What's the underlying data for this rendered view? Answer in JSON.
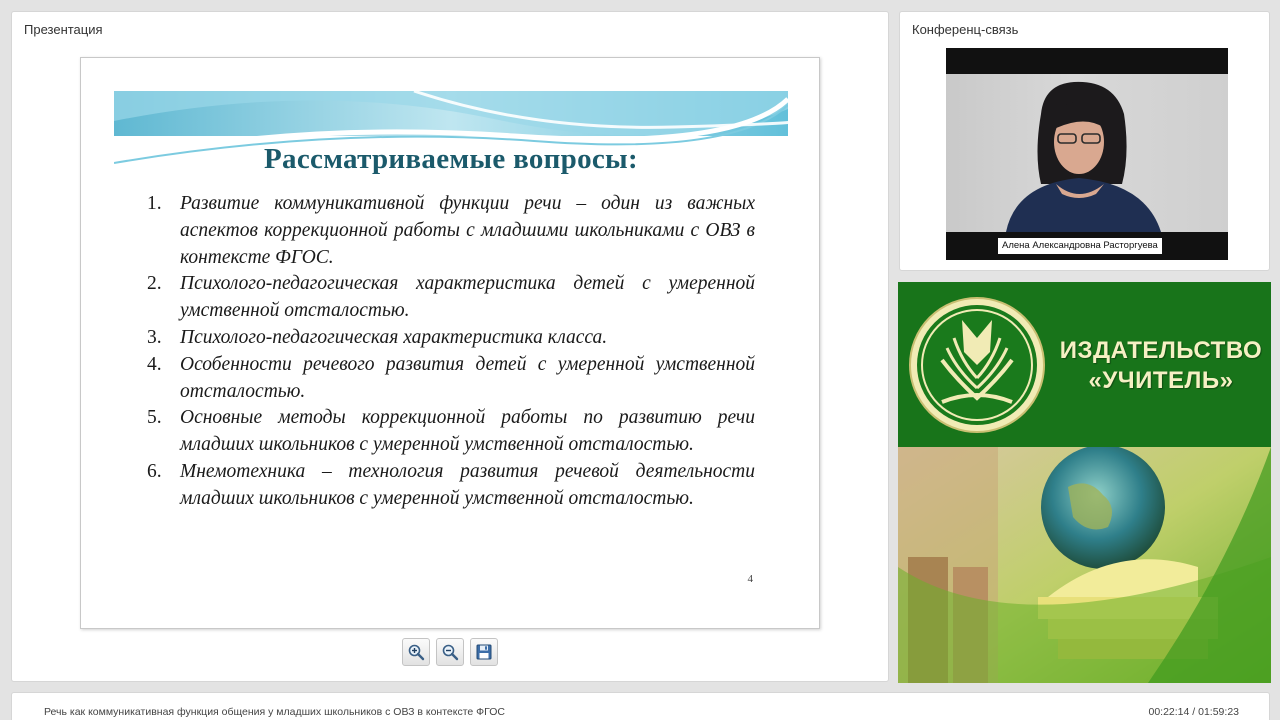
{
  "presentation_panel": {
    "title": "Презентация",
    "slide": {
      "heading": "Рассматриваемые вопросы:",
      "items": [
        {
          "num": "1.",
          "text": "Развитие коммуникативной функции речи – один из важных аспектов коррекционной работы с младшими школьниками с ОВЗ в контексте ФГОС."
        },
        {
          "num": "2.",
          "text": "Психолого-педагогическая характеристика детей с умеренной умственной отсталостью."
        },
        {
          "num": "3.",
          "text": "Психолого-педагогическая характеристика класса."
        },
        {
          "num": "4.",
          "text": "Особенности речевого развития детей с умеренной умственной отсталостью."
        },
        {
          "num": "5.",
          "text": "Основные методы коррекционной работы по развитию речи младших школьников с умеренной умственной отсталостью."
        },
        {
          "num": "6.",
          "text": "Мнемотехника – технология развития речевой деятельности младших школьников с умеренной умственной отсталостью."
        }
      ],
      "page_number": "4"
    },
    "toolbar": {
      "zoom_in_icon": "zoom-in-icon",
      "zoom_out_icon": "zoom-out-icon",
      "save_icon": "save-icon"
    }
  },
  "conference_panel": {
    "title": "Конференц-связь",
    "participant_name": "Алена Александровна Расторгуева"
  },
  "ad_panel": {
    "brand_line1": "ИЗДАТЕЛЬСТВО",
    "brand_line2": "«УЧИТЕЛЬ»"
  },
  "bottom_bar": {
    "lecture_title": "Речь как коммуникативная функция общения у младших школьников с ОВЗ в контексте ФГОС",
    "time_current": "00:22:14",
    "time_separator": "/",
    "time_total": "01:59:23"
  },
  "colors": {
    "slide_heading": "#1b5a6b",
    "brand_green": "#18741a",
    "brand_text": "#f6f0c4",
    "banner_teal": "#6fc6dc"
  }
}
